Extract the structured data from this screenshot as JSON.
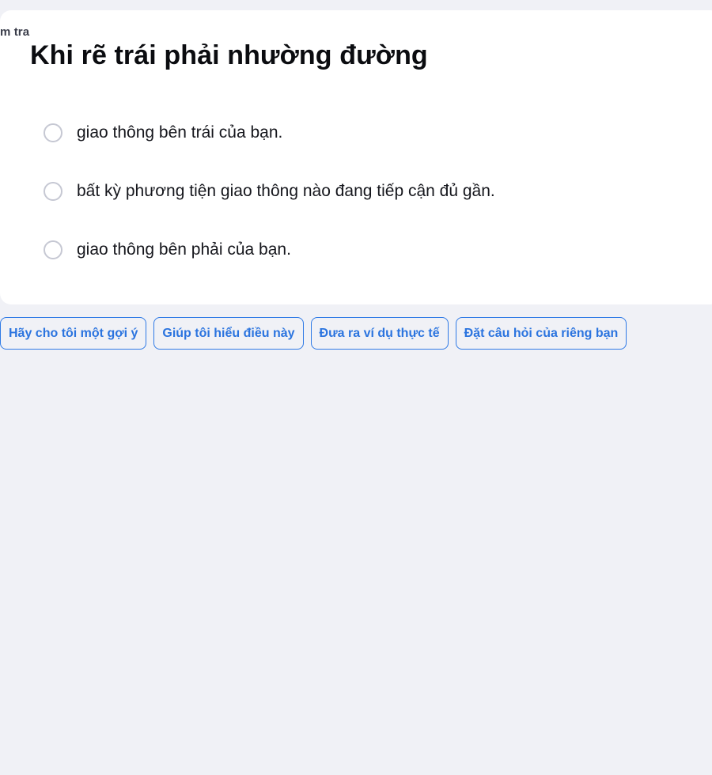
{
  "card": {
    "label": "m tra",
    "question": "Khi rẽ trái phải nhường đường"
  },
  "options": [
    {
      "text": "giao thông bên trái của bạn."
    },
    {
      "text": "bất kỳ phương tiện giao thông nào đang tiếp cận đủ gần."
    },
    {
      "text": "giao thông bên phải của bạn."
    }
  ],
  "actions": [
    {
      "label": "Hãy cho tôi một gợi ý"
    },
    {
      "label": "Giúp tôi hiểu điều này"
    },
    {
      "label": "Đưa ra ví dụ thực tế"
    },
    {
      "label": "Đặt câu hỏi của riêng bạn"
    }
  ],
  "colors": {
    "page_background": "#f0f1f6",
    "card_background": "#ffffff",
    "accent": "#2b74df",
    "radio_border": "#c6c8d3"
  }
}
